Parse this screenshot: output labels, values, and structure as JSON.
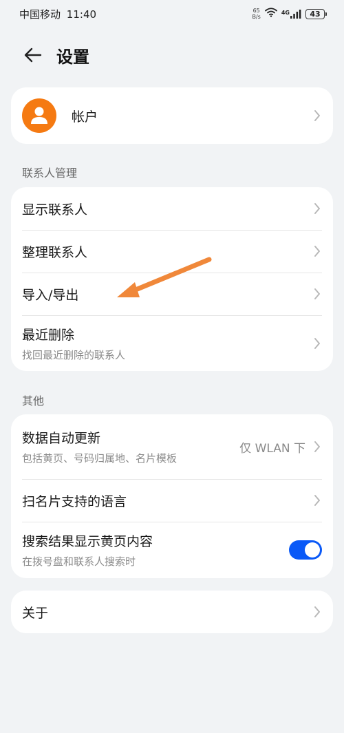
{
  "status_bar": {
    "carrier": "中国移动",
    "time": "11:40",
    "net_speed_value": "65",
    "net_speed_unit": "B/s",
    "network": "4G",
    "battery": "43"
  },
  "header": {
    "title": "设置"
  },
  "account": {
    "label": "帐户"
  },
  "contacts_section": {
    "label": "联系人管理",
    "items": [
      {
        "title": "显示联系人"
      },
      {
        "title": "整理联系人"
      },
      {
        "title": "导入/导出"
      },
      {
        "title": "最近删除",
        "subtitle": "找回最近删除的联系人"
      }
    ]
  },
  "other_section": {
    "label": "其他",
    "items": [
      {
        "title": "数据自动更新",
        "subtitle": "包括黄页、号码归属地、名片模板",
        "value": "仅 WLAN 下"
      },
      {
        "title": "扫名片支持的语言"
      },
      {
        "title": "搜索结果显示黄页内容",
        "subtitle": "在拨号盘和联系人搜索时",
        "toggle_on": true
      }
    ]
  },
  "about": {
    "label": "关于"
  },
  "colors": {
    "accent": "#0a59f7",
    "avatar": "#f57a12",
    "annotation_arrow": "#f0883a",
    "background": "#f1f3f5"
  }
}
